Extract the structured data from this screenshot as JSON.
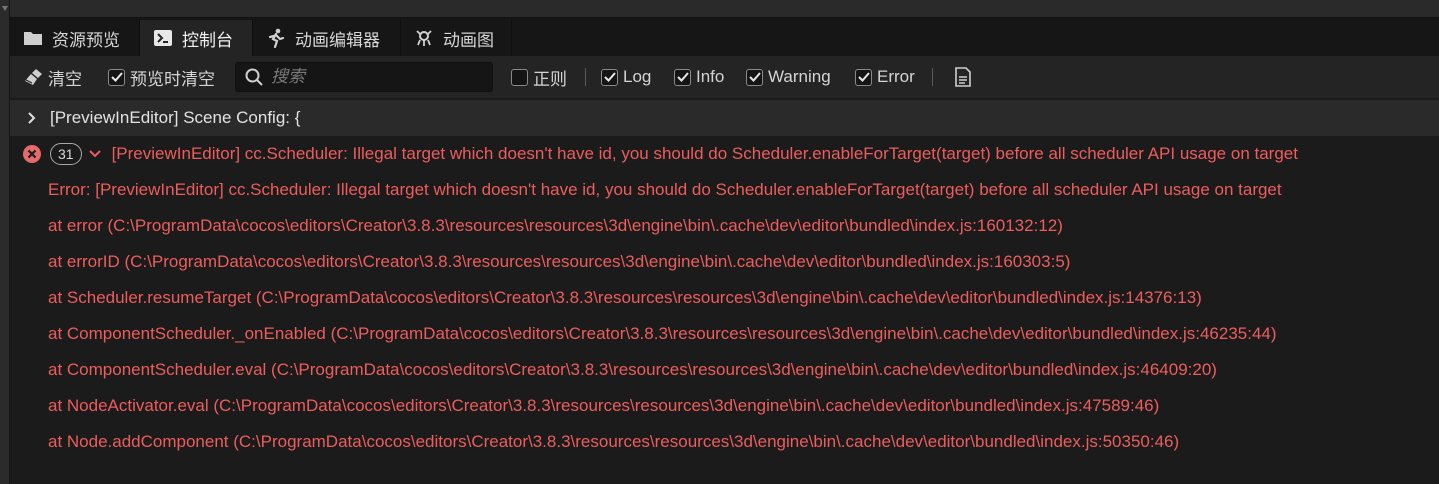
{
  "tabs": [
    {
      "label": "资源预览",
      "icon": "folder-icon",
      "active": false
    },
    {
      "label": "控制台",
      "icon": "terminal-icon",
      "active": true
    },
    {
      "label": "动画编辑器",
      "icon": "running-figure-icon",
      "active": false
    },
    {
      "label": "动画图",
      "icon": "animation-graph-icon",
      "active": false
    }
  ],
  "toolbar": {
    "clear_label": "清空",
    "clear_on_preview_label": "预览时清空",
    "clear_on_preview_checked": true,
    "search_placeholder": "搜索",
    "search_value": "",
    "regex_label": "正则",
    "regex_checked": false,
    "log_label": "Log",
    "log_checked": true,
    "info_label": "Info",
    "info_checked": true,
    "warning_label": "Warning",
    "warning_checked": true,
    "error_label": "Error",
    "error_checked": true
  },
  "logs": {
    "scene_config": "[PreviewInEditor] Scene Config: {",
    "error_count": "31",
    "error_message": "[PreviewInEditor] cc.Scheduler: Illegal target which doesn't have id, you should do Scheduler.enableForTarget(target) before all scheduler API usage on target",
    "stack": [
      "Error: [PreviewInEditor] cc.Scheduler: Illegal target which doesn't have id, you should do Scheduler.enableForTarget(target) before all scheduler API usage on target",
      "at error (C:\\ProgramData\\cocos\\editors\\Creator\\3.8.3\\resources\\resources\\3d\\engine\\bin\\.cache\\dev\\editor\\bundled\\index.js:160132:12)",
      "at errorID (C:\\ProgramData\\cocos\\editors\\Creator\\3.8.3\\resources\\resources\\3d\\engine\\bin\\.cache\\dev\\editor\\bundled\\index.js:160303:5)",
      "at Scheduler.resumeTarget (C:\\ProgramData\\cocos\\editors\\Creator\\3.8.3\\resources\\resources\\3d\\engine\\bin\\.cache\\dev\\editor\\bundled\\index.js:14376:13)",
      "at ComponentScheduler._onEnabled (C:\\ProgramData\\cocos\\editors\\Creator\\3.8.3\\resources\\resources\\3d\\engine\\bin\\.cache\\dev\\editor\\bundled\\index.js:46235:44)",
      "at ComponentScheduler.eval (C:\\ProgramData\\cocos\\editors\\Creator\\3.8.3\\resources\\resources\\3d\\engine\\bin\\.cache\\dev\\editor\\bundled\\index.js:46409:20)",
      "at NodeActivator.eval (C:\\ProgramData\\cocos\\editors\\Creator\\3.8.3\\resources\\resources\\3d\\engine\\bin\\.cache\\dev\\editor\\bundled\\index.js:47589:46)",
      "at Node.addComponent (C:\\ProgramData\\cocos\\editors\\Creator\\3.8.3\\resources\\resources\\3d\\engine\\bin\\.cache\\dev\\editor\\bundled\\index.js:50350:46)"
    ]
  },
  "colors": {
    "error_text": "#ec5d5d",
    "background": "#1b1b1b",
    "toolbar_bg": "#242424"
  }
}
